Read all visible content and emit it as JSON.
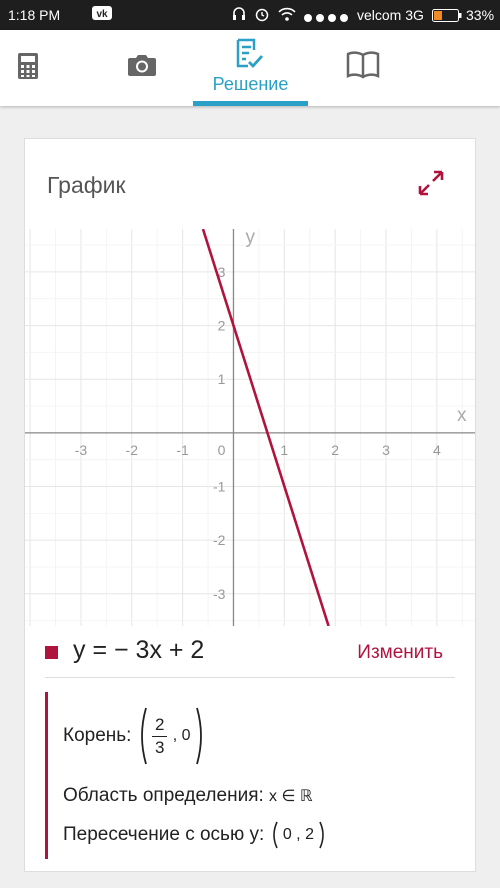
{
  "status": {
    "time": "1:18 PM",
    "carrier": "velcom 3G",
    "battery": "33%",
    "signal_bars": 4,
    "battery_level": 0.33
  },
  "nav": {
    "tabs": [
      {
        "icon": "calculator-icon",
        "label": ""
      },
      {
        "icon": "camera-icon",
        "label": ""
      },
      {
        "icon": "solution-icon",
        "label": "Решение",
        "active": true
      },
      {
        "icon": "book-icon",
        "label": ""
      }
    ]
  },
  "card": {
    "title": "График"
  },
  "chart_data": {
    "type": "line",
    "xlabel": "x",
    "ylabel": "y",
    "xlim": [
      -4.1,
      4.75
    ],
    "ylim": [
      -3.6,
      3.8
    ],
    "x_ticks": [
      "-3",
      "-2",
      "-1",
      "0",
      "1",
      "2",
      "3",
      "4"
    ],
    "x_tick_values": [
      -3,
      -2,
      -1,
      0,
      1,
      2,
      3,
      4
    ],
    "y_ticks": [
      "3",
      "2",
      "1",
      "-1",
      "-2",
      "-3"
    ],
    "y_tick_values": [
      3,
      2,
      1,
      -1,
      -2,
      -3
    ],
    "grid": true,
    "series": [
      {
        "slope": -3,
        "intercept": 2,
        "color": "#b0143e",
        "x": [
          -0.6,
          1.87
        ],
        "y": [
          3.8,
          -3.6
        ]
      }
    ]
  },
  "legend": {
    "equation": "y = − 3x + 2",
    "color": "#b0143e"
  },
  "edit_label": "Изменить",
  "results": {
    "root_label": "Корень:",
    "root_num": "2",
    "root_den": "3",
    "root_y": ", 0",
    "domain_label": "Область определения:",
    "domain_value": "x ∈ ℝ",
    "intercept_label": "Пересечение с осью y:",
    "intercept_value": "0 , 2"
  },
  "accent_color": "#2aa0c6"
}
